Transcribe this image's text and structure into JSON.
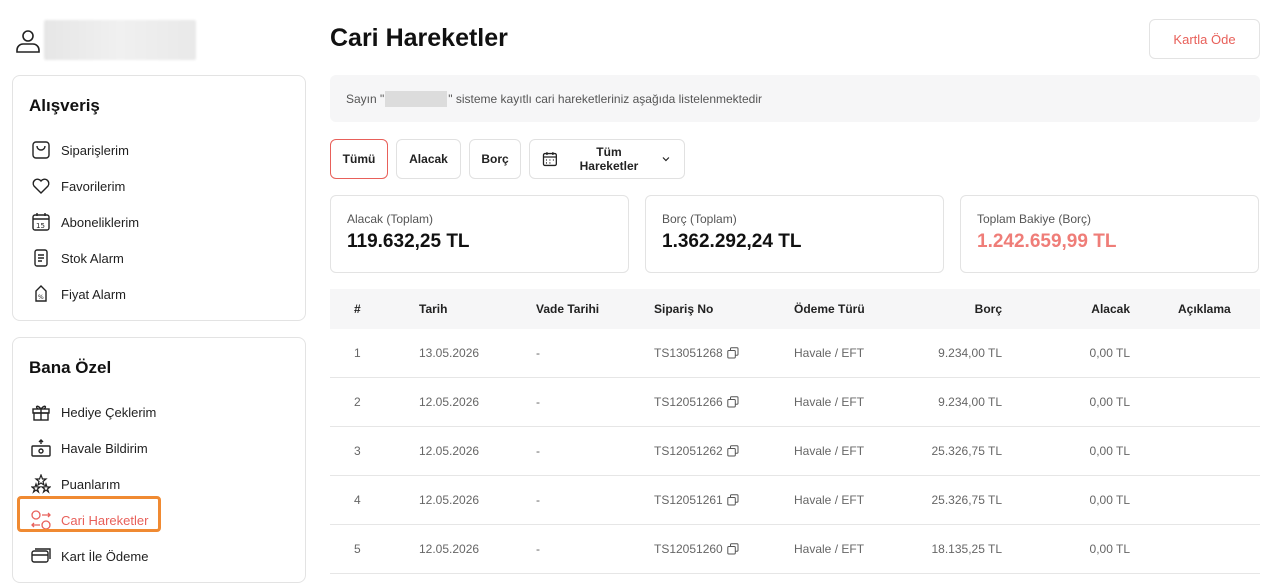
{
  "sidebar": {
    "section1": {
      "title": "Alışveriş",
      "items": [
        {
          "label": "Siparişlerim",
          "icon": "bag-icon"
        },
        {
          "label": "Favorilerim",
          "icon": "heart-icon"
        },
        {
          "label": "Aboneliklerim",
          "icon": "calendar-15-icon"
        },
        {
          "label": "Stok Alarm",
          "icon": "checklist-icon"
        },
        {
          "label": "Fiyat Alarm",
          "icon": "price-tag-icon"
        }
      ]
    },
    "section2": {
      "title": "Bana Özel",
      "items": [
        {
          "label": "Hediye Çeklerim",
          "icon": "gift-icon"
        },
        {
          "label": "Havale Bildirim",
          "icon": "transfer-icon"
        },
        {
          "label": "Puanlarım",
          "icon": "stars-icon"
        },
        {
          "label": "Cari Hareketler",
          "icon": "exchange-icon",
          "active": true
        },
        {
          "label": "Kart İle Ödeme",
          "icon": "card-icon"
        }
      ]
    }
  },
  "header": {
    "title": "Cari Hareketler",
    "pay_button": "Kartla Öde"
  },
  "info": {
    "prefix": "Sayın \"",
    "suffix": "\" sisteme kayıtlı cari hareketleriniz aşağıda listelenmektedir"
  },
  "filters": {
    "all": "Tümü",
    "credit": "Alacak",
    "debit": "Borç",
    "dropdown": "Tüm Hareketler"
  },
  "stats": [
    {
      "label": "Alacak (Toplam)",
      "value": "119.632,25 TL"
    },
    {
      "label": "Borç (Toplam)",
      "value": "1.362.292,24 TL"
    },
    {
      "label": "Toplam Bakiye (Borç)",
      "value": "1.242.659,99 TL"
    }
  ],
  "table": {
    "headers": [
      "#",
      "Tarih",
      "Vade Tarihi",
      "Sipariş No",
      "Ödeme Türü",
      "Borç",
      "Alacak",
      "Açıklama"
    ],
    "rows": [
      [
        "1",
        "13.05.2026",
        "-",
        "TS13051268",
        "Havale / EFT",
        "9.234,00 TL",
        "0,00 TL",
        ""
      ],
      [
        "2",
        "12.05.2026",
        "-",
        "TS12051266",
        "Havale / EFT",
        "9.234,00 TL",
        "0,00 TL",
        ""
      ],
      [
        "3",
        "12.05.2026",
        "-",
        "TS12051262",
        "Havale / EFT",
        "25.326,75 TL",
        "0,00 TL",
        ""
      ],
      [
        "4",
        "12.05.2026",
        "-",
        "TS12051261",
        "Havale / EFT",
        "25.326,75 TL",
        "0,00 TL",
        ""
      ],
      [
        "5",
        "12.05.2026",
        "-",
        "TS12051260",
        "Havale / EFT",
        "18.135,25 TL",
        "0,00 TL",
        ""
      ]
    ]
  },
  "colors": {
    "accent": "#e8605a",
    "highlight": "#f08a32",
    "balance": "#ef7d78"
  }
}
